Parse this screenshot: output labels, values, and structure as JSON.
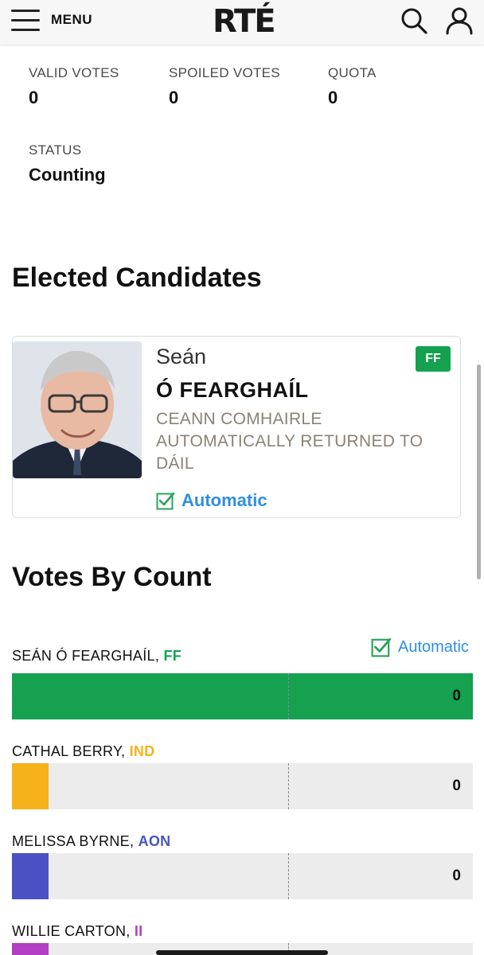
{
  "header": {
    "menu_label": "MENU",
    "logo": "RTÉ"
  },
  "stats": {
    "valid_votes_label": "VALID VOTES",
    "valid_votes_value": "0",
    "spoiled_votes_label": "SPOILED VOTES",
    "spoiled_votes_value": "0",
    "quota_label": "QUOTA",
    "quota_value": "0",
    "status_label": "STATUS",
    "status_value": "Counting"
  },
  "elected": {
    "heading": "Elected Candidates",
    "candidate": {
      "first_name": "Seán",
      "surname": "Ó FEARGHAÍL",
      "party": "FF",
      "note": "CEANN COMHAIRLE AUTOMATICALLY RETURNED TO DÁIL",
      "status": "Automatic"
    }
  },
  "votes_by_count": {
    "heading": "Votes By Count",
    "auto_label": "Automatic",
    "rows": [
      {
        "name": "SEÁN Ó FEARGHAÍL, ",
        "party": "FF",
        "value": "0",
        "party_color": "#15a14f",
        "fill_color": "#15a14f",
        "fill_fraction": 1.0
      },
      {
        "name": "CATHAL BERRY, ",
        "party": "IND",
        "value": "0",
        "party_color": "#f6b21b",
        "fill_color": "#f6b21b",
        "fill_fraction": 0.08
      },
      {
        "name": "MELISSA BYRNE, ",
        "party": "AON",
        "value": "0",
        "party_color": "#4a52c3",
        "fill_color": "#4a52c3",
        "fill_fraction": 0.08
      },
      {
        "name": "WILLIE CARTON, ",
        "party": "II",
        "value": "",
        "party_color": "#b23fc4",
        "fill_color": "#b23fc4",
        "fill_fraction": 0.08
      }
    ]
  }
}
